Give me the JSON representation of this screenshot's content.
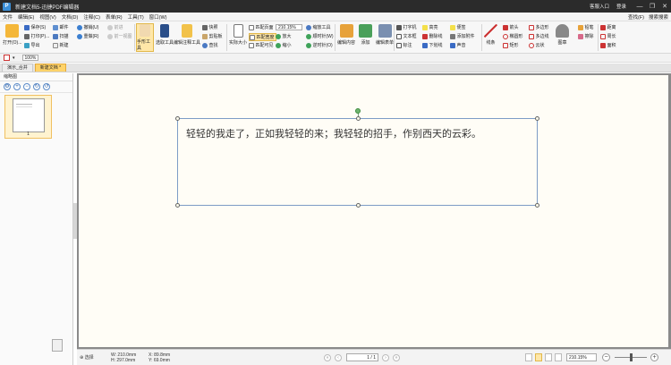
{
  "titlebar": {
    "app_title": "新建文档5-迅捷PDF编辑器",
    "account": "客服入口",
    "login": "登录",
    "minimize": "—",
    "restore": "❐",
    "close": "✕"
  },
  "menu": {
    "items": [
      "文件",
      "编辑(E)",
      "视图(V)",
      "文档(D)",
      "注释(C)",
      "表单(R)",
      "工具(T)",
      "窗口(W)"
    ],
    "right": [
      "查找(F)",
      "搜索搜索"
    ]
  },
  "ribbon": {
    "open": "打开(O)...",
    "save": "保存(S)",
    "print": "打印(P)...",
    "export": "导出",
    "email": "邮件",
    "scan": "扫描",
    "new": "新建",
    "undo": "撤销(U)",
    "redo": "重做(R)",
    "prev_view": "前一视图",
    "forward": "前进",
    "hand_tool": "手形工具",
    "select_tool": "选取工具",
    "edit_annot": "编辑注释工具",
    "snapshot": "快照",
    "clipboard": "剪贴板",
    "find": "查找",
    "actual_size": "实际大小",
    "fit_page": "匹配页面",
    "fit_width": "匹配宽度",
    "fit_visible": "匹配可见",
    "zoom_value": "210.15%",
    "zoom_tool": "缩放工具",
    "zoom_in": "放大",
    "zoom_out": "缩小",
    "rotate_cw": "顺时针(W)",
    "rotate_ccw": "逆时针(O)",
    "edit_content": "编辑内容",
    "add": "添加",
    "edit_form": "编辑表单",
    "typewriter": "打字机",
    "textbox": "文本框",
    "callout": "标注",
    "highlight": "高亮",
    "strikeout": "删除线",
    "underline": "下划线",
    "note": "便签",
    "attach_file": "添加附件",
    "sound": "声音",
    "line": "线条",
    "arrow": "箭头",
    "ellipse": "椭圆形",
    "rectangle": "矩形",
    "polygon": "多边形",
    "polyline": "多边线",
    "cloud": "云状",
    "stamp": "图章",
    "pencil": "铅笔",
    "eraser": "擦除",
    "measure_dist": "距离",
    "measure_perim": "周长",
    "measure_area": "面积"
  },
  "quickbar": {
    "zoom": "100%"
  },
  "tabs": [
    "演示_合并",
    "新建文档 *"
  ],
  "sidebar": {
    "title": "缩略图",
    "page_number": "1"
  },
  "document": {
    "text": "轻轻的我走了，正如我轻轻的来；我轻轻的招手，作别西天的云彩。"
  },
  "statusbar": {
    "select": "选择",
    "width": "W: 210.0mm",
    "height": "H: 297.0mm",
    "x": "X: 89.8mm",
    "y": "Y: 69.0mm",
    "page": "1 / 1",
    "zoom": "210.15%"
  },
  "colors": {
    "accent": "#ffd36a",
    "titlebar": "#2b2b2b",
    "textbox_border": "#7d9cc6"
  }
}
